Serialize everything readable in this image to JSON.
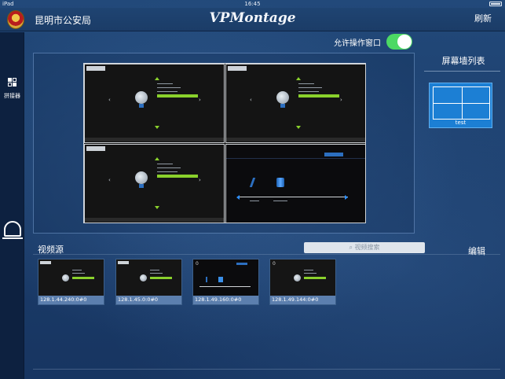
{
  "status_bar": {
    "carrier": "iPad",
    "time": "16:45"
  },
  "header": {
    "unit_name": "昆明市公安局",
    "app_title": "VPMontage",
    "refresh_label": "刷新"
  },
  "sidebar": {
    "items": [
      {
        "label": "拼接器"
      },
      {
        "label": ""
      }
    ]
  },
  "allow_window": {
    "label": "允许操作窗口",
    "enabled": true
  },
  "screen_list": {
    "title": "屏幕墙列表",
    "items": [
      {
        "name": "test",
        "selected": true
      }
    ]
  },
  "sources": {
    "title": "视频源",
    "search_placeholder": "视频搜索",
    "edit_label": "编辑",
    "items": [
      {
        "name": "128.1.44.240:0#0"
      },
      {
        "name": "128.1.45.0:0#0"
      },
      {
        "name": "128.1.49.160:0#0",
        "tag": "0"
      },
      {
        "name": "128.1.49.144:0#0",
        "tag": "0"
      }
    ]
  },
  "colors": {
    "accent": "#1c7fd4",
    "toggle_on": "#4cd964",
    "source_caption": "#5c7fae",
    "highlight_bar": "#8ad12c"
  }
}
